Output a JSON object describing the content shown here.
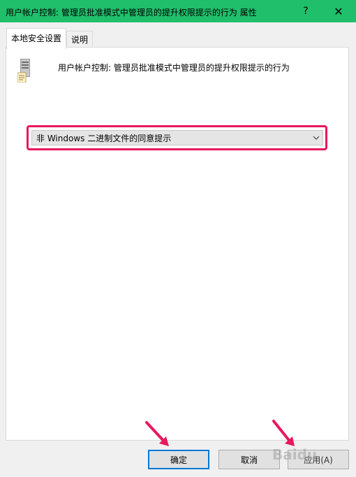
{
  "window": {
    "title": "用户帐户控制: 管理员批准模式中管理员的提升权限提示的行为 属性",
    "help_label": "?",
    "close_label": "✕"
  },
  "tabs": [
    {
      "label": "本地安全设置",
      "active": true
    },
    {
      "label": "说明",
      "active": false
    }
  ],
  "policy": {
    "icon": "server-policy-icon",
    "name": "用户帐户控制: 管理员批准模式中管理员的提升权限提示的行为"
  },
  "dropdown": {
    "selected": "非 Windows 二进制文件的同意提示",
    "highlight_color": "#e8185e"
  },
  "buttons": {
    "ok": "确定",
    "cancel": "取消",
    "apply": "应用(A)"
  },
  "watermark": "Baidu",
  "colors": {
    "titlebar": "#1fbf6b",
    "annotation": "#e8185e",
    "focus": "#0078d7"
  }
}
